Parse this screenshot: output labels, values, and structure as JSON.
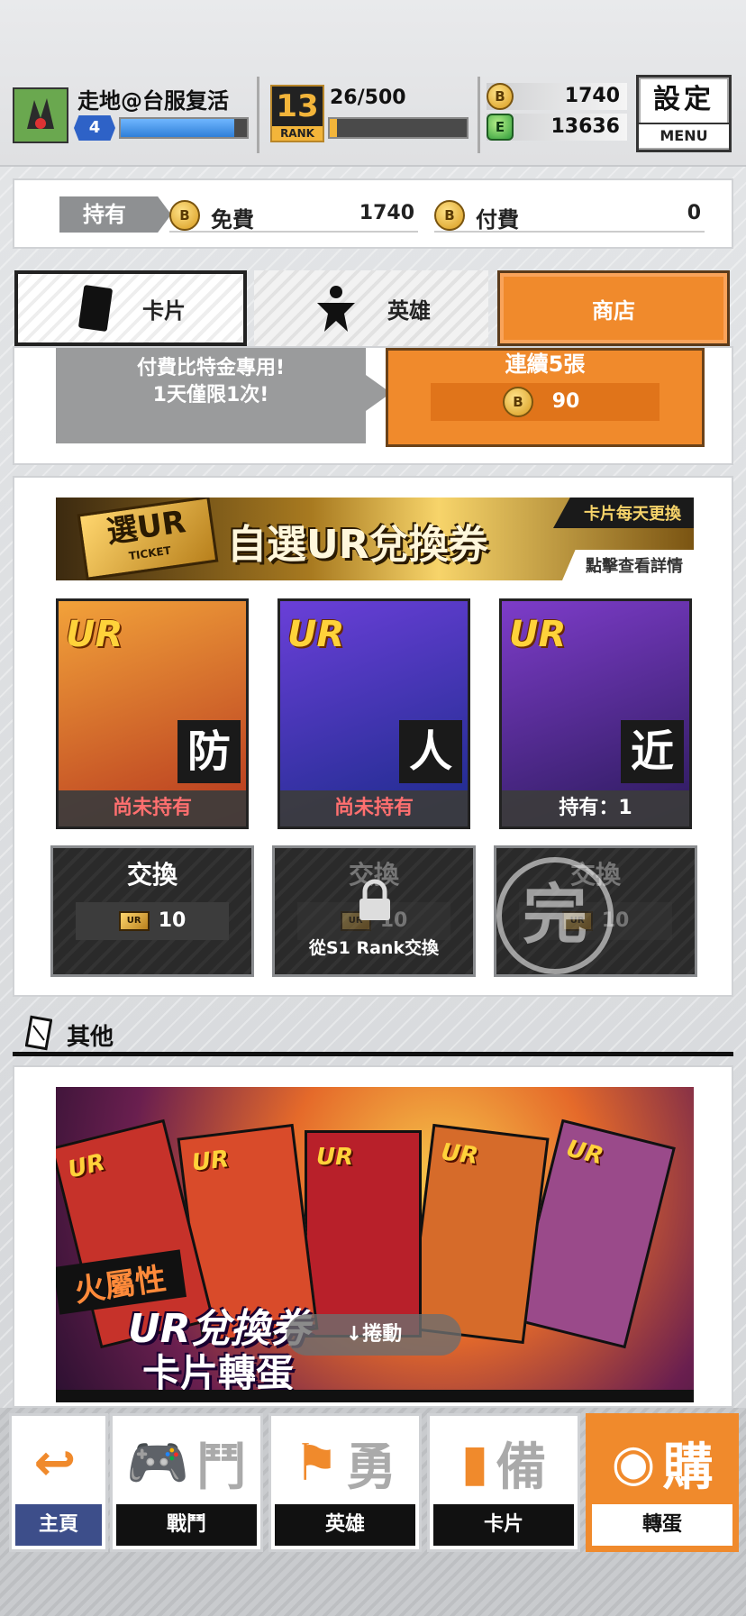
{
  "player": {
    "name": "走地@台服复活",
    "level": "4",
    "level_progress": 0.9
  },
  "rank": {
    "badge_number": "13",
    "badge_label": "RANK",
    "progress_text": "26/500",
    "progress": 0.05
  },
  "currencies": {
    "gold": "1740",
    "energy": "13636",
    "gold_icon_letter": "B",
    "energy_icon_letter": "E"
  },
  "menu": {
    "kanji": "設定",
    "label": "MENU"
  },
  "owned": {
    "tag": "持有",
    "free_label": "免費",
    "free_value": "1740",
    "paid_label": "付費",
    "paid_value": "0"
  },
  "tabs": {
    "cards": "卡片",
    "heroes": "英雄",
    "shop": "商店"
  },
  "gacha": {
    "bubble_line1": "付費比特金專用!",
    "bubble_line2": "1天僅限1次!",
    "pull_title": "連續5張",
    "pull_cost": "90"
  },
  "ur_ticket": {
    "logo_top": "選UR",
    "logo_bottom": "TICKET",
    "title": "自選UR兌換券",
    "daily_note": "卡片每天更換",
    "detail_link": "點擊查看詳情",
    "cards": [
      {
        "rarity": "UR",
        "attribute": "防",
        "status": "尚未持有",
        "owned": false,
        "colors": [
          "#f2a23a",
          "#b5361e"
        ]
      },
      {
        "rarity": "UR",
        "attribute": "人",
        "status": "尚未持有",
        "owned": false,
        "colors": [
          "#6a3fd8",
          "#1b2b8a"
        ]
      },
      {
        "rarity": "UR",
        "attribute": "近",
        "status": "持有：1",
        "owned": true,
        "colors": [
          "#7d3cc9",
          "#2a1a5a"
        ]
      }
    ],
    "exchange_buttons": [
      {
        "label": "交換",
        "cost": "10",
        "state": "available"
      },
      {
        "label": "交換",
        "cost": "10",
        "state": "locked",
        "lock_message": "從S1 Rank交換"
      },
      {
        "label": "交換",
        "cost": "10",
        "state": "done",
        "stamp": "完"
      }
    ],
    "ticket_mini": "UR"
  },
  "others": {
    "header": "其他",
    "banner": {
      "tag": "火屬性",
      "title": "UR兌換券",
      "subtitle": "卡片轉蛋",
      "card_labels": [
        "UR",
        "UR",
        "UR",
        "UR",
        "UR"
      ],
      "card_colors": [
        "#c6322a",
        "#d94b2a",
        "#b8202a",
        "#d66b2a",
        "#9a4a8a"
      ]
    },
    "scroll_hint": "↓捲動"
  },
  "bottom_nav": [
    {
      "label": "主頁",
      "glyph": "↩",
      "kanji": "",
      "active": false
    },
    {
      "label": "戰鬥",
      "glyph": "🎮",
      "kanji": "鬥",
      "active": false
    },
    {
      "label": "英雄",
      "glyph": "⚑",
      "kanji": "勇",
      "active": false
    },
    {
      "label": "卡片",
      "glyph": "▮",
      "kanji": "備",
      "active": false
    },
    {
      "label": "轉蛋",
      "glyph": "◉",
      "kanji": "購",
      "active": true
    }
  ]
}
